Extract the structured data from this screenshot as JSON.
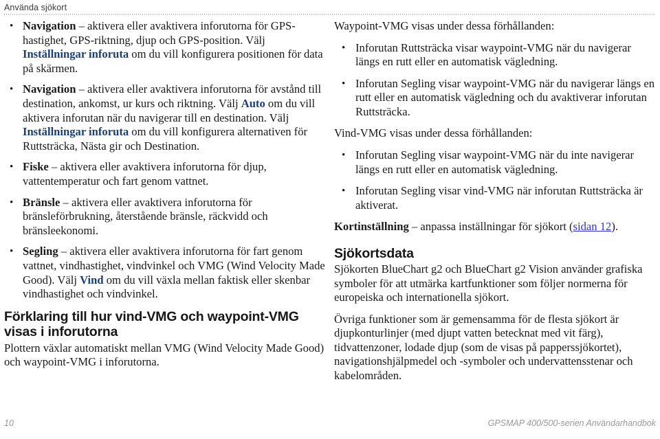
{
  "header": {
    "running_title": "Använda sjökort"
  },
  "left_column": {
    "bullets": [
      {
        "id": "navigation-gps",
        "segments": [
          {
            "text": "Navigation",
            "style": "bold"
          },
          {
            "text": " – aktivera eller avaktivera inforutorna för GPS-hastighet, GPS-riktning, djup och GPS-position. Välj ",
            "style": "normal"
          },
          {
            "text": "Inställningar inforuta",
            "style": "blue-bold"
          },
          {
            "text": " om du vill konfigurera positionen för data på skärmen.",
            "style": "normal"
          }
        ]
      },
      {
        "id": "navigation-destination",
        "segments": [
          {
            "text": "Navigation",
            "style": "bold"
          },
          {
            "text": " – aktivera eller avaktivera inforutorna för avstånd till destination, ankomst, ur kurs och riktning. Välj ",
            "style": "normal"
          },
          {
            "text": "Auto",
            "style": "blue-bold"
          },
          {
            "text": " om du vill aktivera inforutan när du navigerar till en destination. Välj ",
            "style": "normal"
          },
          {
            "text": "Inställningar inforuta",
            "style": "blue-bold"
          },
          {
            "text": " om du vill konfigurera alternativen för Ruttsträcka, Nästa gir och Destination.",
            "style": "normal"
          }
        ]
      },
      {
        "id": "fiske",
        "segments": [
          {
            "text": "Fiske",
            "style": "bold"
          },
          {
            "text": " – aktivera eller avaktivera inforutorna för djup, vattentemperatur och fart genom vattnet.",
            "style": "normal"
          }
        ]
      },
      {
        "id": "bransle",
        "segments": [
          {
            "text": "Bränsle",
            "style": "bold"
          },
          {
            "text": " – aktivera eller avaktivera inforutorna för bränsleförbrukning, återstående bränsle, räckvidd och bränsleekonomi.",
            "style": "normal"
          }
        ]
      },
      {
        "id": "segling",
        "segments": [
          {
            "text": "Segling",
            "style": "bold"
          },
          {
            "text": " – aktivera eller avaktivera inforutorna för fart genom vattnet, vindhastighet, vindvinkel och VMG (Wind Velocity Made Good). Välj ",
            "style": "normal"
          },
          {
            "text": "Vind",
            "style": "blue-bold"
          },
          {
            "text": " om du vill växla mellan faktisk eller skenbar vindhastighet och vindvinkel.",
            "style": "normal"
          }
        ]
      }
    ],
    "section_heading": "Förklaring till hur vind-VMG och waypoint-VMG visas i inforutorna",
    "section_paragraph": "Plottern växlar automatiskt mellan VMG (Wind Velocity Made Good) och waypoint-VMG i inforutorna."
  },
  "right_column": {
    "intro_waypoint": "Waypoint-VMG visas under dessa förhållanden:",
    "waypoint_bullets": [
      "Inforutan Ruttsträcka visar waypoint-VMG när du navigerar längs en rutt eller en automatisk vägledning.",
      "Inforutan Segling visar waypoint-VMG när du navigerar längs en rutt eller en automatisk vägledning och du avaktiverar inforutan Ruttsträcka."
    ],
    "intro_vind": "Vind-VMG visas under dessa förhållanden:",
    "vind_bullets": [
      "Inforutan Segling visar waypoint-VMG när du inte navigerar längs en rutt eller en automatisk vägledning.",
      "Inforutan Segling visar vind-VMG när inforutan Ruttsträcka är aktiverat."
    ],
    "kortinstallning": {
      "term": "Kortinställning",
      "text_before_link": " – anpassa inställningar för sjökort (",
      "link_text": "sidan 12",
      "text_after_link": ")."
    },
    "section_heading": "Sjökortsdata",
    "paragraph_1": "Sjökorten BlueChart g2 och BlueChart g2 Vision använder grafiska symboler för att utmärka kartfunktioner som följer normerna för europeiska och internationella sjökort.",
    "paragraph_2": "Övriga funktioner som är gemensamma för de flesta sjökort är djupkonturlinjer (med djupt vatten betecknat med vit färg), tidvattenzoner, lodade djup (som de visas på papperssjökortet), navigationshjälpmedel och -symboler och undervattensstenar och kabelområden."
  },
  "footer": {
    "page_number": "10",
    "manual_title": "GPSMAP 400/500-serien Användarhandbok"
  },
  "colors": {
    "emphasis_blue": "#1c3f73",
    "link_blue": "#3434c8",
    "footer_gray": "#9a9a9a",
    "rule_gray": "#b9b9b9"
  },
  "icons": {
    "bullet": "•"
  }
}
